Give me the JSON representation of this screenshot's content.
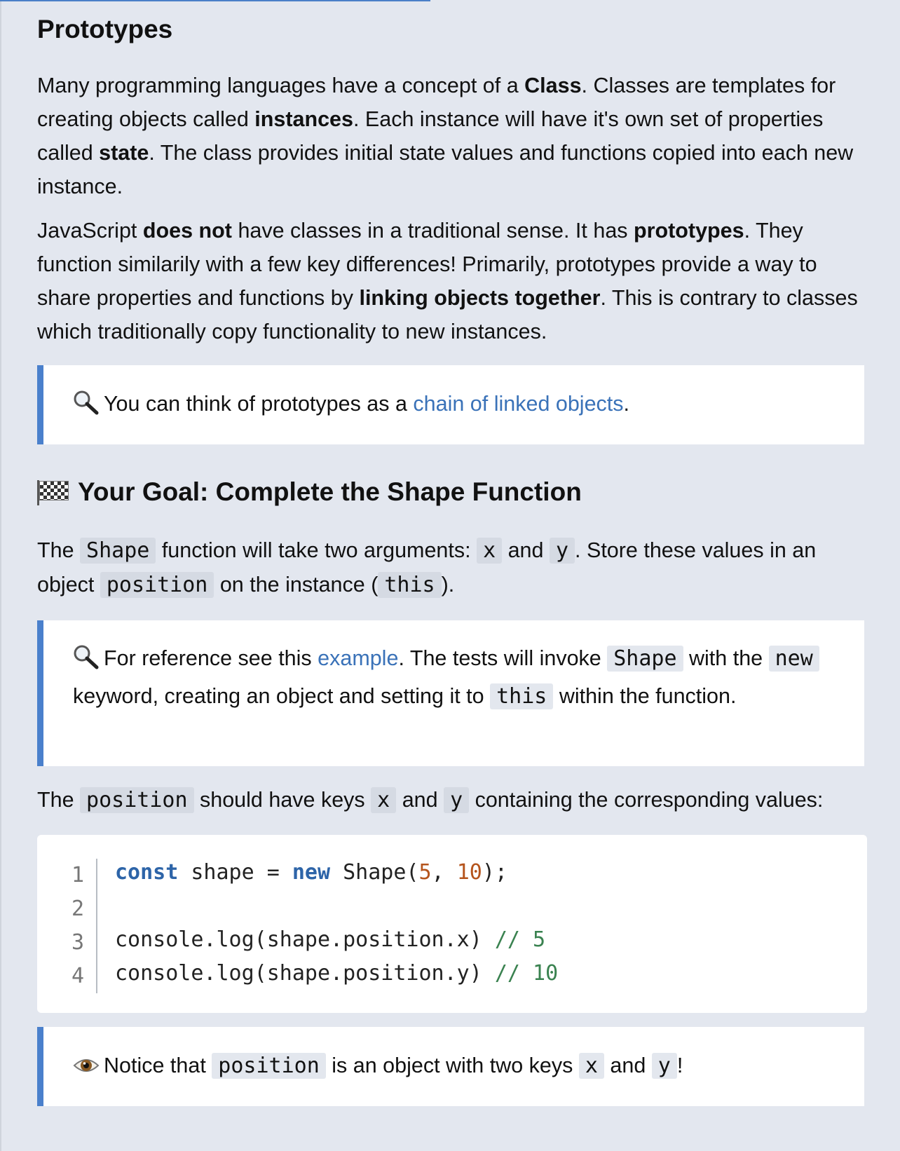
{
  "page": {
    "title": "Prototypes"
  },
  "intro": {
    "p1_a": "Many programming languages have a concept of a ",
    "p1_b": "Class",
    "p1_c": ". Classes are templates for creating objects called ",
    "p1_d": "instances",
    "p1_e": ". Each instance will have it's own set of properties called ",
    "p1_f": "state",
    "p1_g": ". The class provides initial state values and functions copied into each new instance.",
    "p2_a": "JavaScript ",
    "p2_b": "does not",
    "p2_c": " have classes in a traditional sense. It has ",
    "p2_d": "prototypes",
    "p2_e": ". They function similarily with a few key differences! Primarily, prototypes provide a way to share properties and functions by ",
    "p2_f": "linking objects together",
    "p2_g": ". This is contrary to classes which traditionally copy functionality to new instances."
  },
  "callout1": {
    "icon": "magnifying-glass-icon",
    "text_a": "You can think of prototypes as a ",
    "link": "chain of linked objects",
    "text_b": "."
  },
  "goal": {
    "icon": "checkered-flag-icon",
    "heading": "Your Goal: Complete the Shape Function",
    "p3_a": "The ",
    "p3_code1": "Shape",
    "p3_b": " function will take two arguments: ",
    "p3_code2": "x",
    "p3_c": " and ",
    "p3_code3": "y",
    "p3_d": ". Store these values in an object ",
    "p3_code4": "position",
    "p3_e": " on the instance (",
    "p3_code5": "this",
    "p3_f": ")."
  },
  "callout2": {
    "icon": "magnifying-glass-icon",
    "text_a": "For reference see this ",
    "link": "example",
    "text_b": ". The tests will invoke ",
    "code1": "Shape",
    "text_c": " with the ",
    "code2": "new",
    "text_d": " keyword, creating an object and setting it to ",
    "code3": "this",
    "text_e": " within the function."
  },
  "p4": {
    "a": "The ",
    "code1": "position",
    "b": " should have keys ",
    "code2": "x",
    "c": " and ",
    "code3": "y",
    "d": " containing the corresponding values:"
  },
  "code": {
    "line_numbers": [
      "1",
      "2",
      "3",
      "4"
    ],
    "l1_kw1": "const",
    "l1_a": " shape = ",
    "l1_kw2": "new",
    "l1_b": " Shape(",
    "l1_n1": "5",
    "l1_c": ", ",
    "l1_n2": "10",
    "l1_d": ");",
    "l3_a": "console.log(shape.position.x) ",
    "l3_cm": "// 5",
    "l4_a": "console.log(shape.position.y) ",
    "l4_cm": "// 10"
  },
  "callout3": {
    "icon": "eye-icon",
    "text_a": "Notice that ",
    "code1": "position",
    "text_b": " is an object with two keys ",
    "code2": "x",
    "text_c": " and ",
    "code3": "y",
    "text_d": "!"
  },
  "colors": {
    "background": "#e3e7ef",
    "accent": "#4a80cc",
    "link": "#3a72b8",
    "code_keyword": "#2d64a8",
    "code_number": "#b5541c",
    "code_comment": "#3a8250"
  }
}
